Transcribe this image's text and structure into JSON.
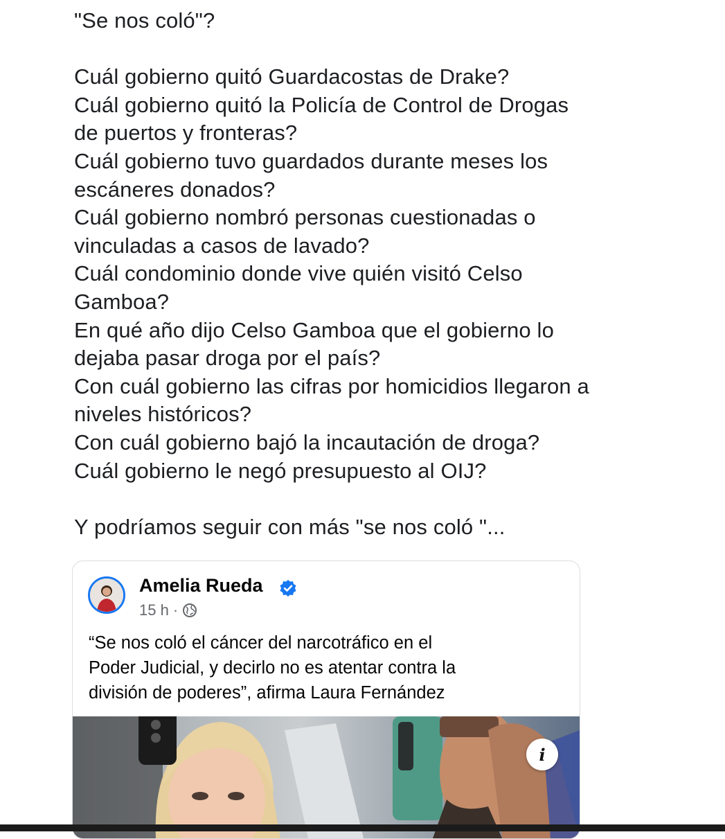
{
  "post": {
    "lines": [
      "\"Se nos coló\"?",
      "",
      "Cuál gobierno quitó Guardacostas de Drake?",
      "Cuál gobierno quitó la Policía de Control de Drogas",
      "de puertos y fronteras?",
      "Cuál gobierno tuvo guardados durante meses los",
      "escáneres donados?",
      "Cuál gobierno nombró personas cuestionadas o",
      "vinculadas a casos de lavado?",
      "Cuál condominio donde vive quién visitó Celso",
      "Gamboa?",
      "En qué año dijo Celso Gamboa que el gobierno lo",
      "dejaba pasar droga por el país?",
      "Con cuál gobierno las cifras por homicidios llegaron a",
      "niveles históricos?",
      "Con cuál gobierno bajó la incautación de droga?",
      "Cuál gobierno le negó presupuesto al OIJ?",
      "",
      "Y podríamos seguir con más \"se nos coló \"..."
    ]
  },
  "shared_post": {
    "author": "Amelia Rueda",
    "time": "15 h",
    "separator": "·",
    "headline_lines": [
      "“Se nos coló el cáncer del narcotráfico en el",
      "Poder Judicial, y decirlo no es atentar contra la",
      "división de poderes”, afirma Laura Fernández"
    ],
    "info_label": "i",
    "icons": {
      "verified": "verified-badge-icon",
      "audience": "globe-icon",
      "info": "info-icon"
    },
    "colors": {
      "verified": "#1877f2",
      "meta": "#65676b"
    }
  }
}
